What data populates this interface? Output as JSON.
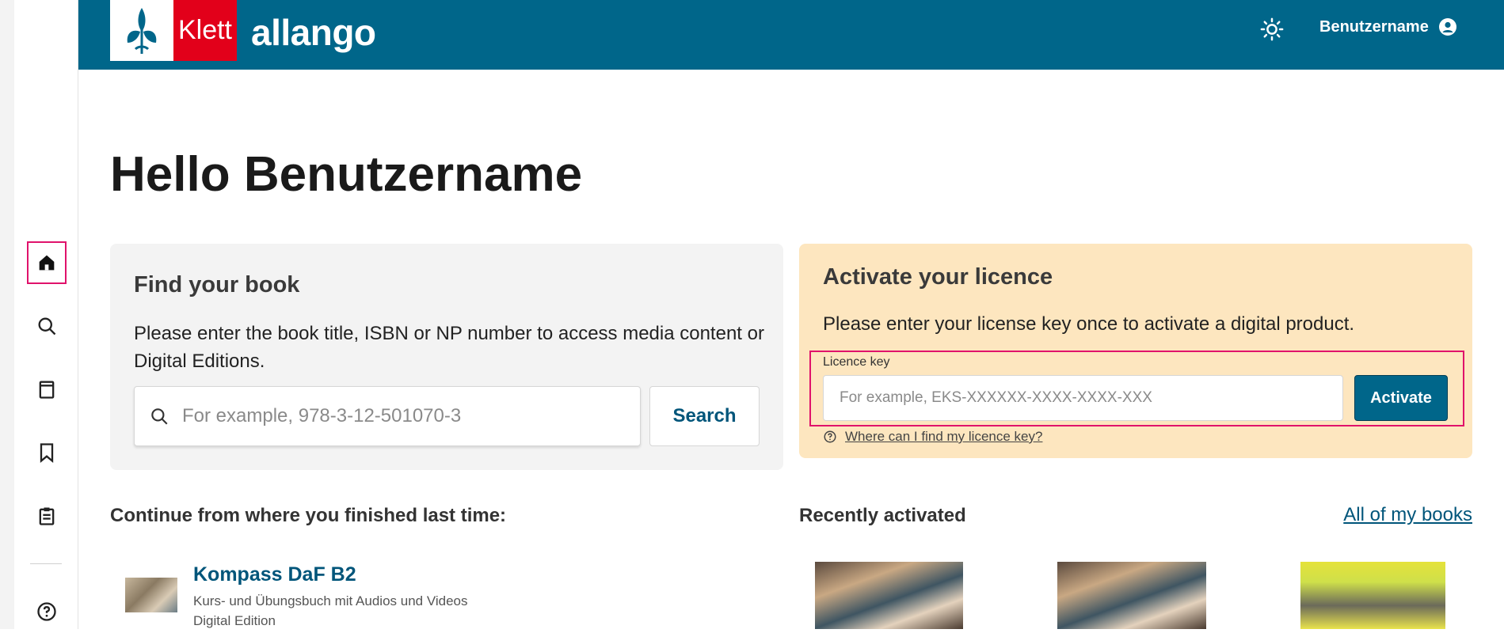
{
  "topbar": {
    "brand_klett": "Klett",
    "brand_name": "allango",
    "username": "Benutzername"
  },
  "greeting": {
    "hello": "Hello",
    "name": "Benutzername"
  },
  "find": {
    "title": "Find your book",
    "description": "Please enter the book title, ISBN or NP number to access media content or Digital Editions.",
    "placeholder": "For example, 978-3-12-501070-3",
    "button": "Search"
  },
  "licence": {
    "title": "Activate your licence",
    "description": "Please enter your license key once to activate a digital product.",
    "label": "Licence key",
    "placeholder": "For example, EKS-XXXXXX-XXXX-XXXX-XXX",
    "button": "Activate",
    "help_link": "Where can I find my licence key?"
  },
  "continue": {
    "title": "Continue from where you finished last time:",
    "book": {
      "title": "Kompass DaF B2",
      "subtitle": "Kurs- und Übungsbuch mit Audios und Videos",
      "edition": "Digital Edition"
    }
  },
  "recent": {
    "title": "Recently activated",
    "all_link": "All of my books"
  },
  "colors": {
    "brand_blue": "#00668a",
    "klett_red": "#e2001a",
    "licence_bg": "#fde6bf",
    "focus_pink": "#e0126b"
  },
  "sidebar_icons": [
    "home-icon",
    "search-icon",
    "book-icon",
    "bookmark-icon",
    "clipboard-icon",
    "help-icon"
  ]
}
